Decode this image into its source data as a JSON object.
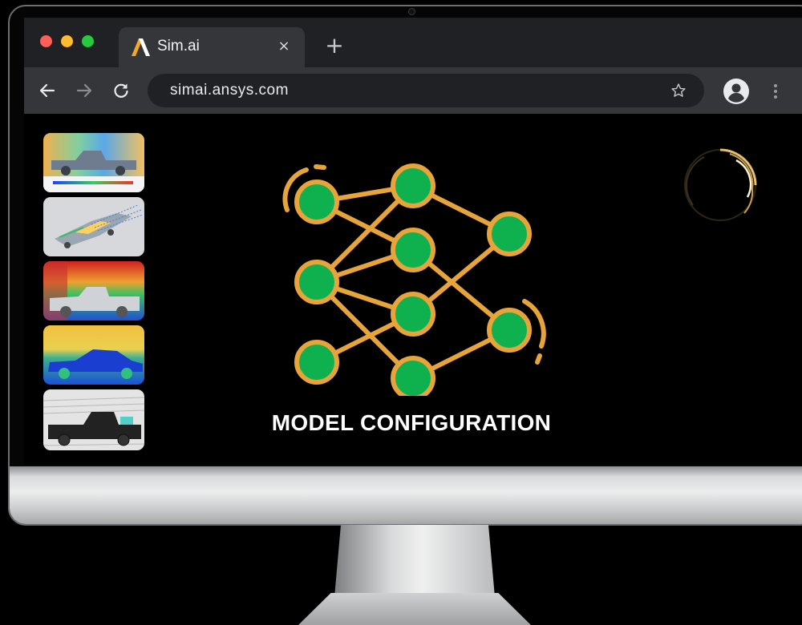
{
  "browser": {
    "tab": {
      "title": "Sim.ai",
      "close_label": "×",
      "logo_icon": "sim-ai-logo-icon"
    },
    "new_tab_label": "+",
    "address_bar": {
      "url": "simai.ansys.com"
    },
    "icons": [
      "back-arrow-icon",
      "forward-arrow-icon",
      "reload-icon",
      "bookmark-star-icon",
      "profile-avatar-icon",
      "more-menu-icon"
    ]
  },
  "content": {
    "thumbnails": [
      {
        "name": "pickup-side-pressure-map"
      },
      {
        "name": "pickup-streamlines-isometric"
      },
      {
        "name": "pickup-velocity-field"
      },
      {
        "name": "sedan-velocity-field"
      },
      {
        "name": "pickup-streamlines-side"
      }
    ],
    "caption": "MODEL CONFIGURATION",
    "network_icon": "neural-network-icon",
    "loader_icon": "loading-spinner-icon"
  },
  "colors": {
    "node_fill": "#0fb04e",
    "node_stroke": "#e6a43b",
    "tab_bar": "#202124",
    "toolbar": "#35363a"
  }
}
